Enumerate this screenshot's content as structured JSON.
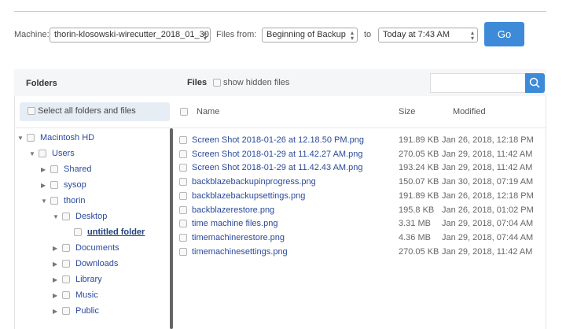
{
  "controls": {
    "machine_label": "Machine:",
    "machine_value": "thorin-klosowski-wirecutter_2018_01_30",
    "from_label": "Files from:",
    "from_value": "Beginning of Backup",
    "to_label": "to",
    "to_value": "Today at 7:43 AM",
    "go_label": "Go"
  },
  "header": {
    "folders": "Folders",
    "files": "Files",
    "show_hidden": "show hidden files",
    "search_placeholder": ""
  },
  "columns": {
    "select_all": "Select all folders and files",
    "name": "Name",
    "size": "Size",
    "modified": "Modified"
  },
  "tree": [
    {
      "label": "Macintosh HD",
      "toggle": "▼",
      "level": 0
    },
    {
      "label": "Users",
      "toggle": "▼",
      "level": 1
    },
    {
      "label": "Shared",
      "toggle": "▶",
      "level": 2
    },
    {
      "label": "sysop",
      "toggle": "▶",
      "level": 2
    },
    {
      "label": "thorin",
      "toggle": "▼",
      "level": 2
    },
    {
      "label": "Desktop",
      "toggle": "▼",
      "level": 3
    },
    {
      "label": "untitled folder",
      "toggle": "",
      "level": 4,
      "selected": true
    },
    {
      "label": "Documents",
      "toggle": "▶",
      "level": 3
    },
    {
      "label": "Downloads",
      "toggle": "▶",
      "level": 3
    },
    {
      "label": "Library",
      "toggle": "▶",
      "level": 3
    },
    {
      "label": "Music",
      "toggle": "▶",
      "level": 3
    },
    {
      "label": "Public",
      "toggle": "▶",
      "level": 3
    }
  ],
  "files": [
    {
      "name": "Screen Shot 2018-01-26 at 12.18.50 PM.png",
      "size": "191.89 KB",
      "modified": "Jan 26, 2018, 12:18 PM"
    },
    {
      "name": "Screen Shot 2018-01-29 at 11.42.27 AM.png",
      "size": "270.05 KB",
      "modified": "Jan 29, 2018, 11:42 AM"
    },
    {
      "name": "Screen Shot 2018-01-29 at 11.42.43 AM.png",
      "size": "193.24 KB",
      "modified": "Jan 29, 2018, 11:42 AM"
    },
    {
      "name": "backblazebackupinprogress.png",
      "size": "150.07 KB",
      "modified": "Jan 30, 2018, 07:19 AM"
    },
    {
      "name": "backblazebackupsettings.png",
      "size": "191.89 KB",
      "modified": "Jan 26, 2018, 12:18 PM"
    },
    {
      "name": "backblazerestore.png",
      "size": "195.8 KB",
      "modified": "Jan 26, 2018, 01:02 PM"
    },
    {
      "name": "time machine files.png",
      "size": "3.31 MB",
      "modified": "Jan 29, 2018, 07:04 AM"
    },
    {
      "name": "timemachinerestore.png",
      "size": "4.36 MB",
      "modified": "Jan 29, 2018, 07:44 AM"
    },
    {
      "name": "timemachinesettings.png",
      "size": "270.05 KB",
      "modified": "Jan 29, 2018, 11:42 AM"
    }
  ],
  "colors": {
    "accent": "#3d8ad8",
    "link": "#2b4a9a"
  }
}
